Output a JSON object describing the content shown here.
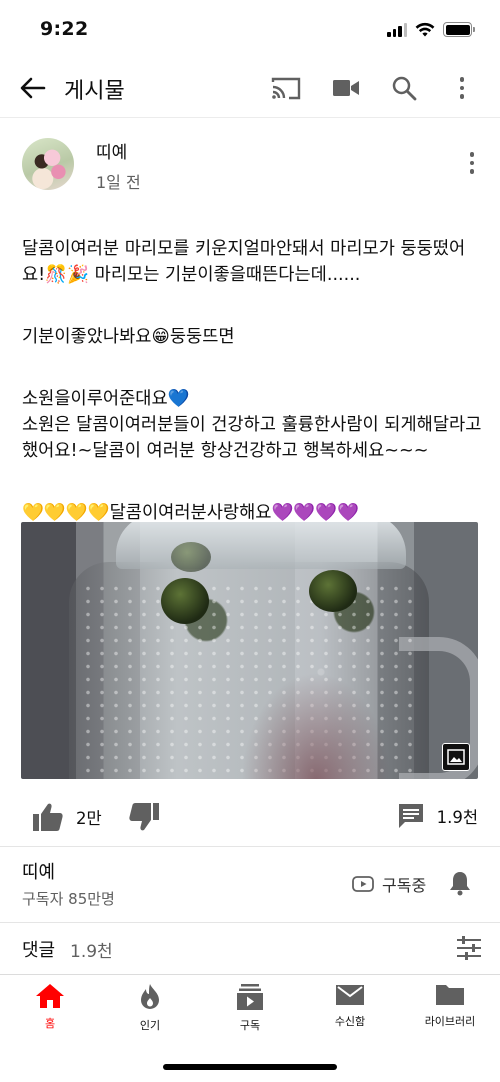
{
  "status_bar": {
    "time": "9:22"
  },
  "header": {
    "title": "게시물"
  },
  "post": {
    "author": "띠예",
    "time": "1일 전",
    "paragraphs": [
      "달콤이여러분 마리모를 키운지얼마안돼서 마리모가 둥둥떴어요!🎊🎉 마리모는 기분이좋을때뜬다는데......",
      "기분이좋았나봐요😁둥둥뜨면",
      "소원을이루어준대요💙\n소원은 달콤이여러분들이 건강하고 훌륭한사람이 되게해달라고했어요!~달콤이 여러분 항상건강하고 행복하세요~~~",
      "💛💛💛💛달콤이여러분사랑해요💜💜💜💜"
    ],
    "likes": "2만",
    "comments_count": "1.9천"
  },
  "channel": {
    "name": "띠예",
    "subscribers": "구독자 85만명",
    "subscribe_label": "구독중"
  },
  "comments": {
    "title": "댓글",
    "count": "1.9천"
  },
  "bottom_nav": [
    {
      "label": "홈",
      "icon": "home-icon",
      "active": true
    },
    {
      "label": "인기",
      "icon": "trending-icon",
      "active": false
    },
    {
      "label": "구독",
      "icon": "subscriptions-icon",
      "active": false
    },
    {
      "label": "수신함",
      "icon": "inbox-icon",
      "active": false
    },
    {
      "label": "라이브러리",
      "icon": "library-icon",
      "active": false
    }
  ],
  "colors": {
    "accent": "#ff0000",
    "text": "#0f0f0f",
    "secondary_text": "#606060"
  }
}
